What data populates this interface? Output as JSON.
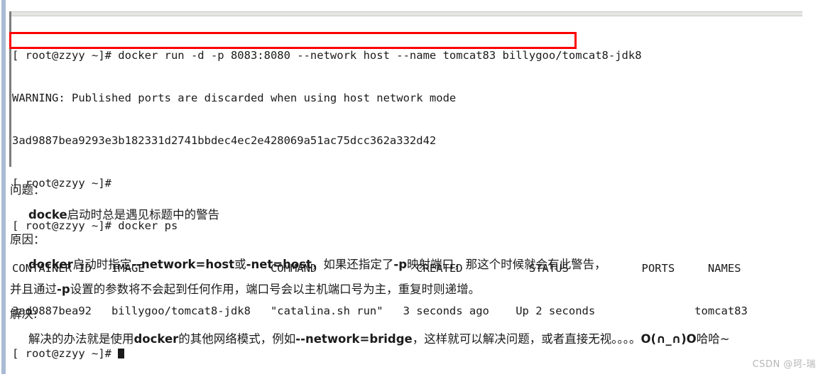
{
  "terminal": {
    "prompt": "[ root@zzyy ~]# ",
    "lines": [
      {
        "id": "cmd-docker-run",
        "text": "[ root@zzyy ~]# docker run -d -p 8083:8080 --network host --name tomcat83 billygoo/tomcat8-jdk8"
      },
      {
        "id": "warning-line",
        "text": "WARNING: Published ports are discarded when using host network mode"
      },
      {
        "id": "container-id",
        "text": "3ad9887bea9293e3b182331d2741bbdec4ec2e428069a51ac75dcc362a332d42"
      },
      {
        "id": "blank-prompt",
        "text": "[ root@zzyy ~]# "
      },
      {
        "id": "cmd-docker-ps",
        "text": "[ root@zzyy ~]# docker ps"
      },
      {
        "id": "ps-header",
        "text": "CONTAINER ID   IMAGE                   COMMAND               CREATED          STATUS           PORTS     NAMES"
      },
      {
        "id": "ps-row",
        "text": "3ad9887bea92   billygoo/tomcat8-jdk8   \"catalina.sh run\"   3 seconds ago    Up 2 seconds               tomcat83"
      },
      {
        "id": "final-prompt",
        "text": "[ root@zzyy ~]# "
      }
    ],
    "ps_table": {
      "columns": [
        "CONTAINER ID",
        "IMAGE",
        "COMMAND",
        "CREATED",
        "STATUS",
        "PORTS",
        "NAMES"
      ],
      "rows": [
        [
          "3ad9887bea92",
          "billygoo/tomcat8-jdk8",
          "\"catalina.sh run\"",
          "3 seconds ago",
          "Up 2 seconds",
          "",
          "tomcat83"
        ]
      ]
    },
    "highlight_color": "#fd0000"
  },
  "prose": {
    "problem_heading": "问题：",
    "problem_body_pre": "docke",
    "problem_body_post": "启动时总是遇见标题中的警告",
    "cause_heading": "原因：",
    "cause_line1_a": "docker",
    "cause_line1_b": "启动时指定",
    "cause_line1_c": "--network=host",
    "cause_line1_d": "或",
    "cause_line1_e": "-net=host",
    "cause_line1_f": "，如果还指定了",
    "cause_line1_g": "-p",
    "cause_line1_h": "映射端口，那这个时候就会有此警告，",
    "cause_line2_a": "并且通过",
    "cause_line2_b": "-p",
    "cause_line2_c": "设置的参数将不会起到任何作用，端口号会以主机端口号为主，重复时则递增。",
    "solution_heading": "解决:",
    "solution_line_a": "解决的办法就是使用",
    "solution_line_b": "docker",
    "solution_line_c": "的其他网络模式，例如",
    "solution_line_d": "--network=bridge",
    "solution_line_e": "，这样就可以解决问题，或者直接无视。。。。",
    "solution_line_f": "O(∩_∩)O",
    "solution_line_g": "哈哈~"
  },
  "watermark": {
    "text": "CSDN @珂-瑞"
  },
  "colors": {
    "page_background": "#ffffff",
    "left_edge": "#a9bbd4",
    "terminal_text": "#1b1b1b",
    "highlight_red": "#fd0000",
    "watermark_gray": "#b6b6b6"
  }
}
